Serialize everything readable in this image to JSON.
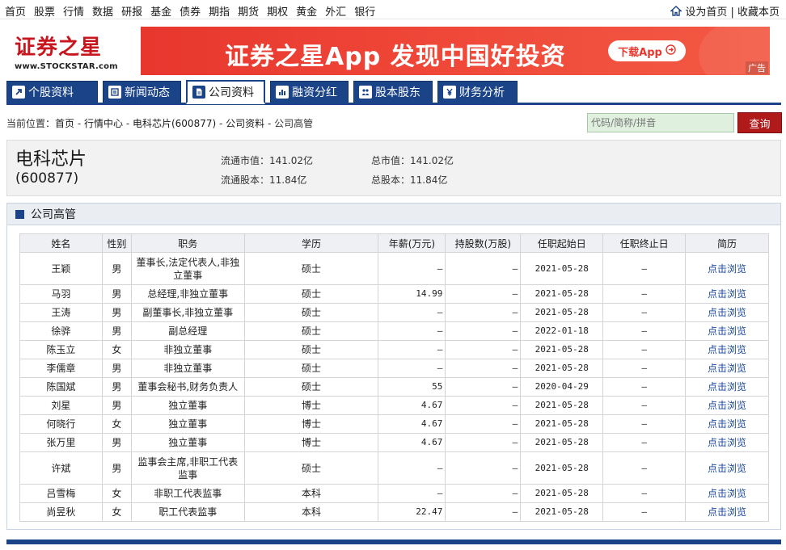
{
  "topnav": {
    "links": [
      "首页",
      "股票",
      "行情",
      "数据",
      "研报",
      "基金",
      "债券",
      "期指",
      "期货",
      "期权",
      "黄金",
      "外汇",
      "银行"
    ],
    "right": "设为首页 | 收藏本页"
  },
  "logo": {
    "cn": "证券之星",
    "en": "www.STOCKSTAR.com"
  },
  "banner": {
    "text": "证券之星App 发现中国好投资",
    "button": "下载App",
    "ad": "广告"
  },
  "tabs": [
    {
      "label": "个股资料",
      "icon": "arrow-icon"
    },
    {
      "label": "新闻动态",
      "icon": "news-icon"
    },
    {
      "label": "公司资料",
      "icon": "doc-icon",
      "active": true
    },
    {
      "label": "融资分红",
      "icon": "bar-icon"
    },
    {
      "label": "股本股东",
      "icon": "people-icon"
    },
    {
      "label": "财务分析",
      "icon": "yen-icon"
    }
  ],
  "breadcrumb": {
    "prefix": "当前位置：",
    "items": [
      "首页",
      "行情中心",
      "电科芯片(600877)",
      "公司资料",
      "公司高管"
    ],
    "sep": " - "
  },
  "search": {
    "placeholder": "代码/简称/拼音",
    "button": "查询"
  },
  "stock": {
    "name": "电科芯片",
    "code": "(600877)",
    "float_mv_label": "流通市值：",
    "float_mv": "141.02亿",
    "total_mv_label": "总市值：",
    "total_mv": "141.02亿",
    "float_shares_label": "流通股本：",
    "float_shares": "11.84亿",
    "total_shares_label": "总股本：",
    "total_shares": "11.84亿"
  },
  "panel": {
    "title": "公司高管"
  },
  "table": {
    "headers": [
      "姓名",
      "性别",
      "职务",
      "学历",
      "年薪(万元)",
      "持股数(万股)",
      "任职起始日",
      "任职终止日",
      "简历"
    ],
    "rows": [
      [
        "王颖",
        "男",
        "董事长,法定代表人,非独立董事",
        "硕士",
        "—",
        "—",
        "2021-05-28",
        "—",
        "点击浏览"
      ],
      [
        "马羽",
        "男",
        "总经理,非独立董事",
        "硕士",
        "14.99",
        "—",
        "2021-05-28",
        "—",
        "点击浏览"
      ],
      [
        "王涛",
        "男",
        "副董事长,非独立董事",
        "硕士",
        "—",
        "—",
        "2021-05-28",
        "—",
        "点击浏览"
      ],
      [
        "徐骅",
        "男",
        "副总经理",
        "硕士",
        "—",
        "—",
        "2022-01-18",
        "—",
        "点击浏览"
      ],
      [
        "陈玉立",
        "女",
        "非独立董事",
        "硕士",
        "—",
        "—",
        "2021-05-28",
        "—",
        "点击浏览"
      ],
      [
        "李儒章",
        "男",
        "非独立董事",
        "硕士",
        "—",
        "—",
        "2021-05-28",
        "—",
        "点击浏览"
      ],
      [
        "陈国斌",
        "男",
        "董事会秘书,财务负责人",
        "硕士",
        "55",
        "—",
        "2020-04-29",
        "—",
        "点击浏览"
      ],
      [
        "刘星",
        "男",
        "独立董事",
        "博士",
        "4.67",
        "—",
        "2021-05-28",
        "—",
        "点击浏览"
      ],
      [
        "何晓行",
        "女",
        "独立董事",
        "博士",
        "4.67",
        "—",
        "2021-05-28",
        "—",
        "点击浏览"
      ],
      [
        "张万里",
        "男",
        "独立董事",
        "博士",
        "4.67",
        "—",
        "2021-05-28",
        "—",
        "点击浏览"
      ],
      [
        "许斌",
        "男",
        "监事会主席,非职工代表监事",
        "硕士",
        "—",
        "—",
        "2021-05-28",
        "—",
        "点击浏览"
      ],
      [
        "吕雪梅",
        "女",
        "非职工代表监事",
        "本科",
        "—",
        "—",
        "2021-05-28",
        "—",
        "点击浏览"
      ],
      [
        "尚昱秋",
        "女",
        "职工代表监事",
        "本科",
        "22.47",
        "—",
        "2021-05-28",
        "—",
        "点击浏览"
      ]
    ]
  },
  "colors": {
    "nav_blue": "#1b4488",
    "brand_red": "#c8161e",
    "search_red": "#b01a1a",
    "link_blue": "#1a47a0"
  }
}
